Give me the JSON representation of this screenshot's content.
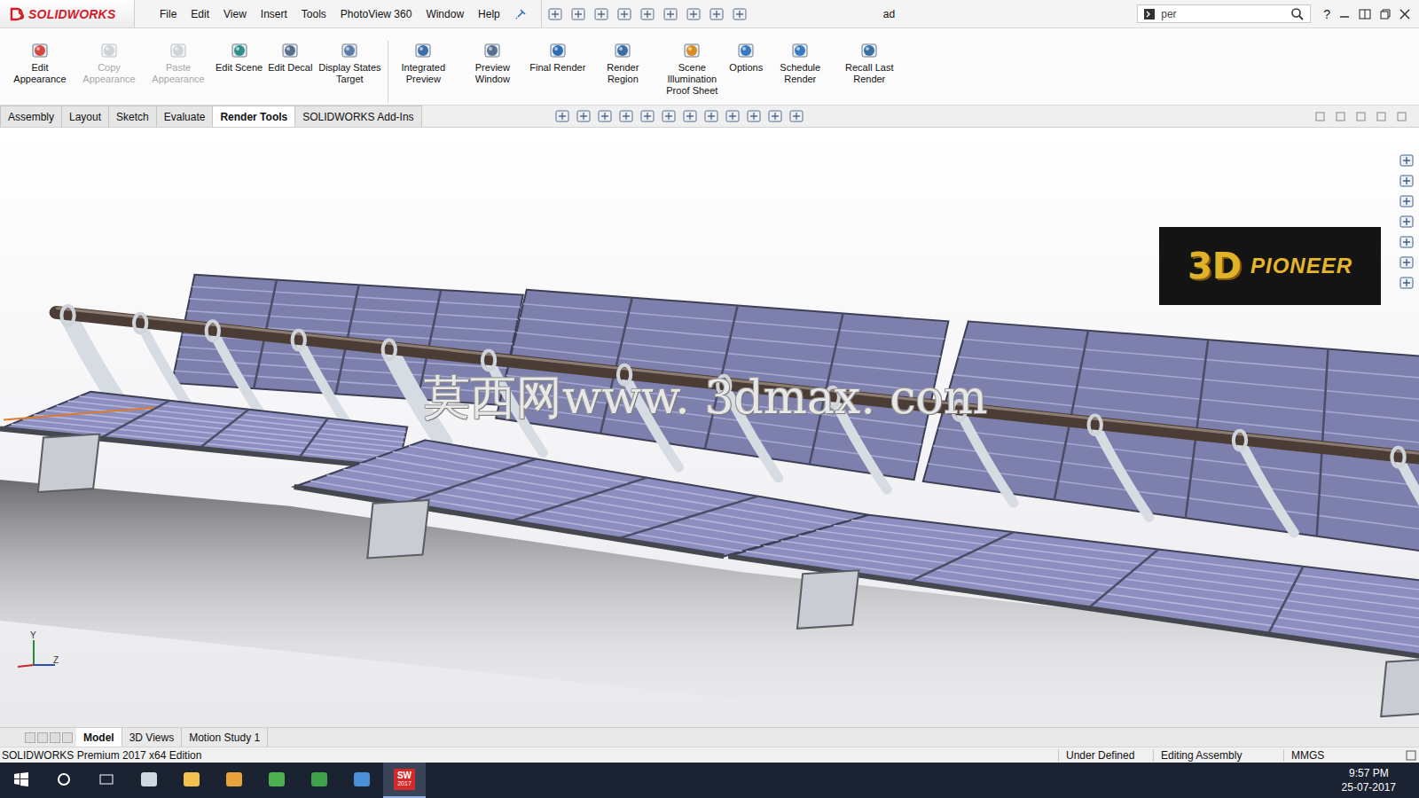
{
  "app": {
    "logo": "SOLIDWORKS"
  },
  "menu": [
    "File",
    "Edit",
    "View",
    "Insert",
    "Tools",
    "PhotoView 360",
    "Window",
    "Help"
  ],
  "document_title": "ad",
  "search": {
    "value": "per"
  },
  "help": "?",
  "ribbon": {
    "groups": [
      [
        {
          "label": "Edit Appearance",
          "disabled": false
        },
        {
          "label": "Copy Appearance",
          "disabled": true
        },
        {
          "label": "Paste Appearance",
          "disabled": true
        },
        {
          "label": "Edit Scene",
          "disabled": false
        },
        {
          "label": "Edit Decal",
          "disabled": false
        },
        {
          "label": "Display States Target",
          "disabled": false
        }
      ],
      [
        {
          "label": "Integrated Preview",
          "disabled": false
        },
        {
          "label": "Preview Window",
          "disabled": false
        },
        {
          "label": "Final Render",
          "disabled": false
        },
        {
          "label": "Render Region",
          "disabled": false
        },
        {
          "label": "Scene Illumination Proof Sheet",
          "disabled": false
        },
        {
          "label": "Options",
          "disabled": false
        },
        {
          "label": "Schedule Render",
          "disabled": false
        },
        {
          "label": "Recall Last Render",
          "disabled": false
        }
      ]
    ]
  },
  "tabs": [
    {
      "label": "Assembly",
      "selected": false
    },
    {
      "label": "Layout",
      "selected": false
    },
    {
      "label": "Sketch",
      "selected": false
    },
    {
      "label": "Evaluate",
      "selected": false
    },
    {
      "label": "Render Tools",
      "selected": true
    },
    {
      "label": "SOLIDWORKS Add-Ins",
      "selected": false
    }
  ],
  "viewport": {
    "watermark": "莫西网www. 3dmax. com",
    "badge": {
      "mark": "3D",
      "text": "PIONEER"
    },
    "triad": [
      "Y",
      "Z"
    ]
  },
  "bottom_tabs": [
    {
      "label": "Model",
      "selected": true
    },
    {
      "label": "3D Views",
      "selected": false
    },
    {
      "label": "Motion Study 1",
      "selected": false
    }
  ],
  "status_bar": {
    "edition": "SOLIDWORKS Premium 2017 x64 Edition",
    "items": [
      "Under Defined",
      "Editing Assembly",
      "MMGS"
    ]
  },
  "taskbar": {
    "time": "9:57 PM",
    "date": "25-07-2017",
    "app_badge": {
      "mark": "SW",
      "version": "2017"
    }
  }
}
